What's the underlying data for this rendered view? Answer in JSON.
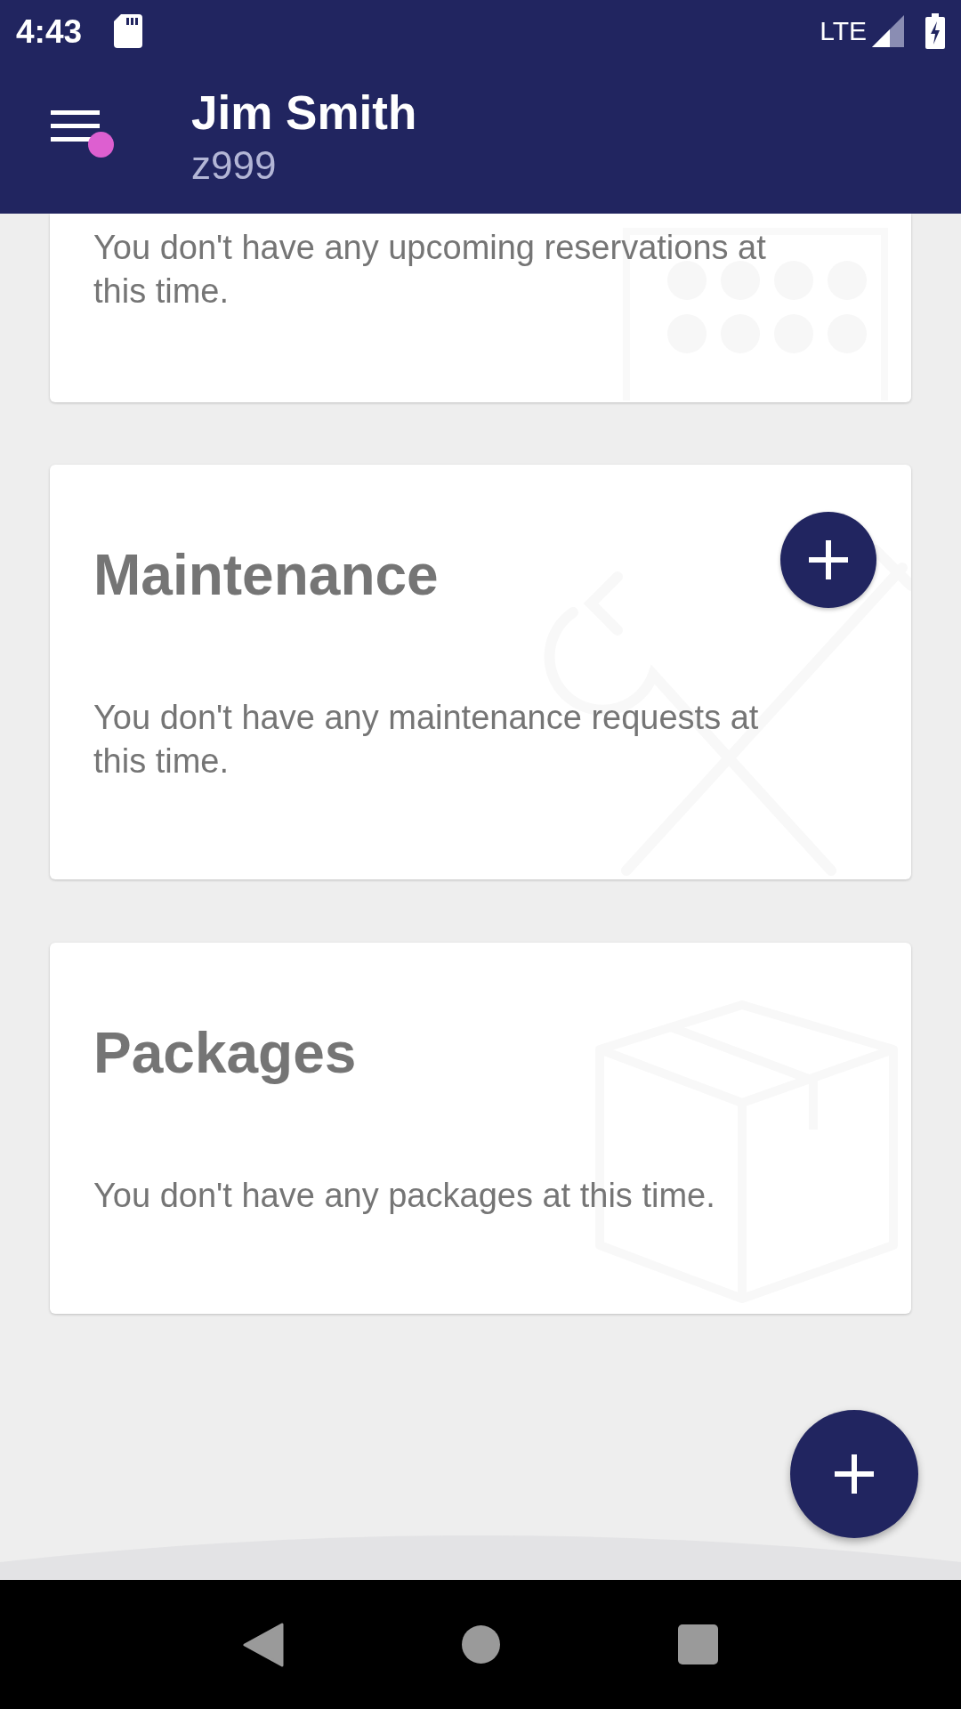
{
  "status_bar": {
    "time": "4:43",
    "network": "LTE"
  },
  "header": {
    "name": "Jim Smith",
    "unit": "z999",
    "menu_badge": true
  },
  "cards": [
    {
      "kind": "reservations",
      "message": "You don't have any upcoming reservations at this time."
    },
    {
      "kind": "maintenance",
      "title": "Maintenance",
      "message": "You don't have any maintenance requests at this time.",
      "add_button": true
    },
    {
      "kind": "packages",
      "title": "Packages",
      "message": "You don't have any packages at this time.",
      "add_button": false
    }
  ]
}
